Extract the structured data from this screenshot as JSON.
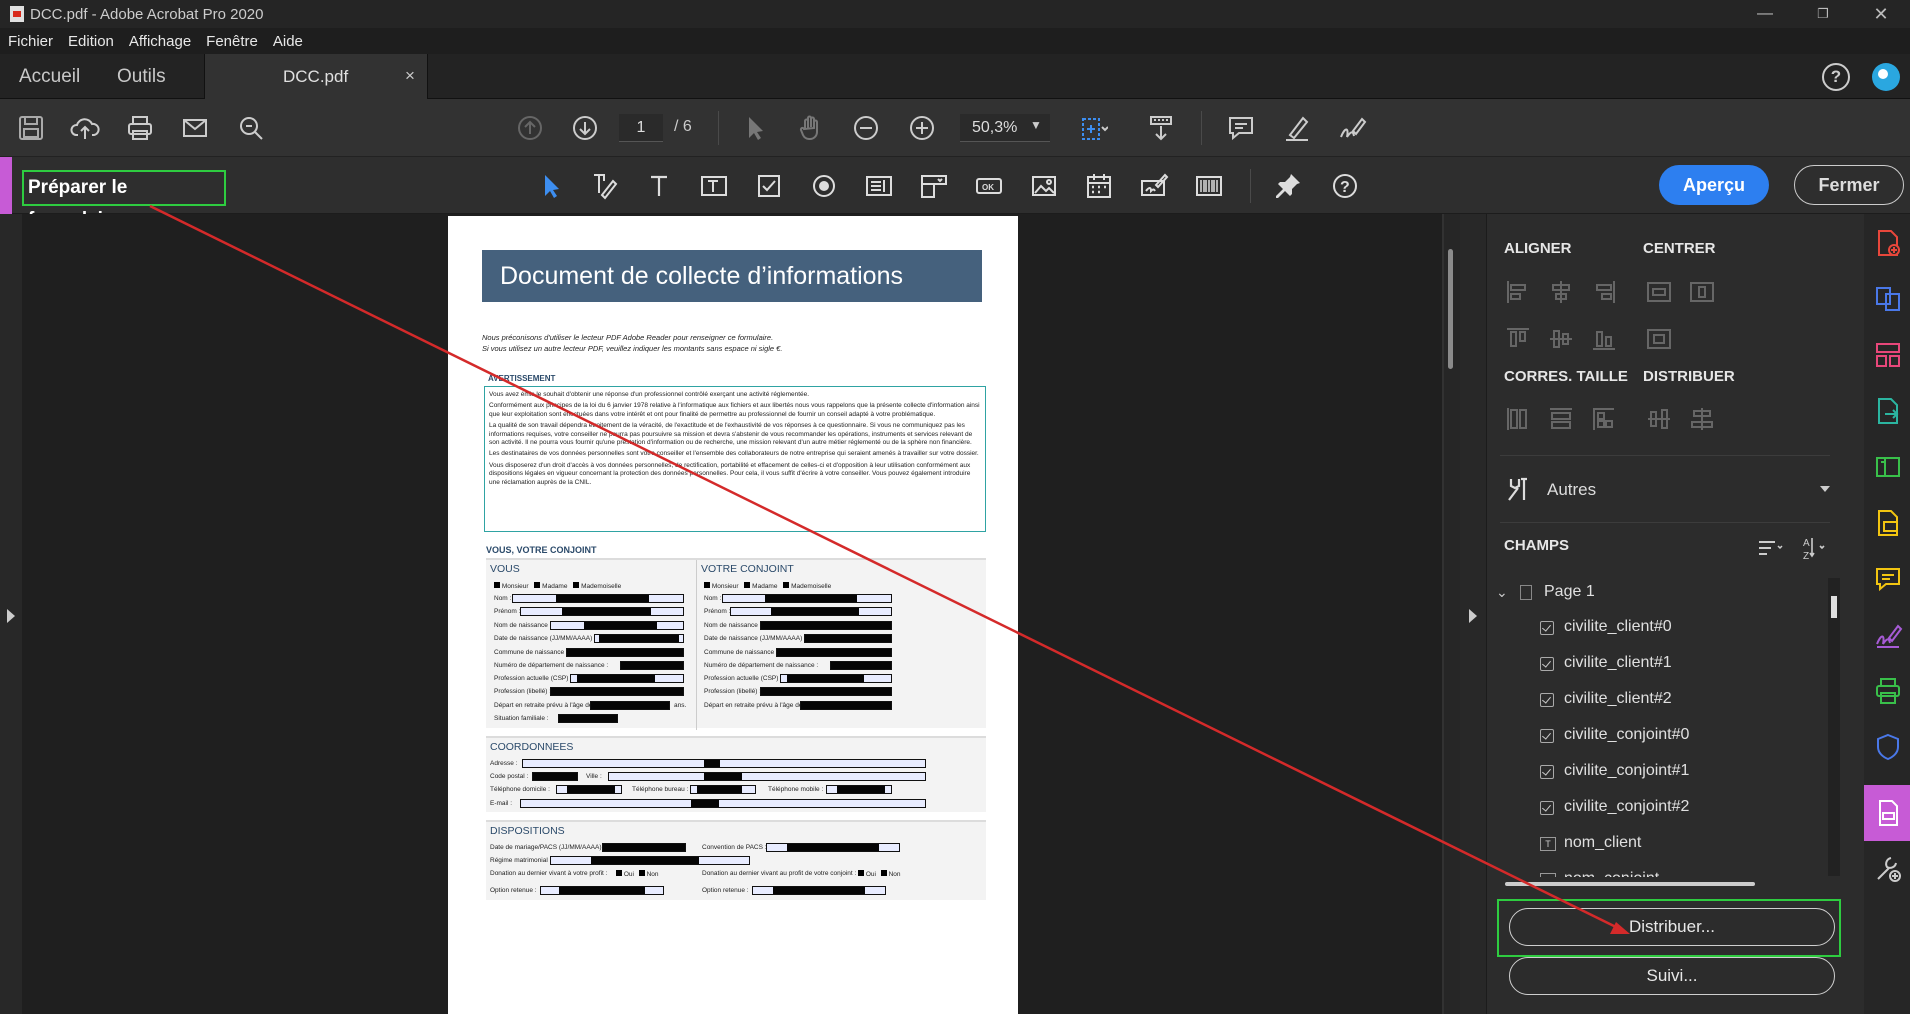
{
  "window": {
    "title": "DCC.pdf - Adobe Acrobat Pro 2020"
  },
  "menu": [
    "Fichier",
    "Edition",
    "Affichage",
    "Fenêtre",
    "Aide"
  ],
  "tabs": {
    "home": "Accueil",
    "tools": "Outils",
    "doc": "DCC.pdf",
    "close": "×"
  },
  "toolbar": {
    "page_current": "1",
    "page_total": "/ 6",
    "zoom": "50,3%"
  },
  "formbar": {
    "title": "Préparer le formulaire",
    "preview": "Aperçu",
    "close": "Fermer"
  },
  "panel": {
    "align": "ALIGNER",
    "center": "CENTRER",
    "resize": "CORRES. TAILLE",
    "distribute": "DISTRIBUER",
    "others": "Autres",
    "fields_title": "CHAMPS",
    "page_node": "Page 1",
    "fields": [
      "civilite_client#0",
      "civilite_client#1",
      "civilite_client#2",
      "civilite_conjoint#0",
      "civilite_conjoint#1",
      "civilite_conjoint#2",
      "nom_client",
      "nom_conjoint"
    ],
    "btn_distribute": "Distribuer...",
    "btn_track": "Suivi..."
  },
  "document": {
    "banner": "Document de collecte d’informations",
    "intro_1": "Nous préconisons d'utiliser le lecteur PDF Adobe Reader pour renseigner ce formulaire.",
    "intro_2": "Si vous utilisez un autre lecteur PDF, veuillez indiquer les montants sans espace ni sigle €.",
    "warning_title": "AVERTISSEMENT",
    "warning_paragraphs": [
      "Vous avez émis le souhait d'obtenir une réponse d'un professionnel contrôlé exerçant une activité réglementée.",
      "Conformément aux principes de la loi du 6 janvier 1978 relative à l'informatique aux fichiers et aux libertés nous vous rappelons que la présente collecte d'information ainsi que leur exploitation sont effectuées dans votre intérêt et ont pour finalité de permettre au professionnel de fournir un conseil adapté à votre problématique.",
      "La qualité de son travail dépendra étroitement de la véracité, de l'exactitude et de l'exhaustivité de vos réponses à ce questionnaire. Si vous ne communiquez pas les informations requises, votre conseiller ne pourra pas poursuivre sa mission et devra s'abstenir de vous recommander les opérations, instruments et services relevant de son activité. Il ne pourra vous fournir qu'une prestation d'information ou de recherche, une mission relevant d'un autre métier réglementé ou de la sphère non financière.",
      "Les destinataires de vos données personnelles sont votre conseiller et l'ensemble des collaborateurs de notre entreprise qui seraient amenés à travailler sur votre dossier.",
      "Vous disposerez d'un droit d'accès à vos données personnelles, de rectification, portabilité et effacement de celles-ci et d'opposition à leur utilisation conformément aux dispositions légales en vigueur concernant la protection des données personnelles. Pour cela, il vous suffit d'écrire à votre conseiller. Vous pouvez également introduire une réclamation auprès de la CNIL."
    ],
    "section_you": "VOUS, VOTRE CONJOINT",
    "col_you": "VOUS",
    "col_spouse": "VOTRE CONJOINT",
    "civility": [
      "Monsieur",
      "Madame",
      "Mademoiselle"
    ],
    "rows": [
      "Nom :",
      "Prénom :",
      "Nom de naissance :",
      "Date de naissance (JJ/MM/AAAA) :",
      "Commune de naissance :",
      "Numéro de département de naissance :",
      "Profession actuelle (CSP) :",
      "Profession (libellé) :",
      "Départ en retraite prévu à l'âge de"
    ],
    "ans": "ans.",
    "situation": "Situation familiale :",
    "coords": "COORDONNEES",
    "adresse": "Adresse :",
    "cp": "Code postal :",
    "ville": "Ville :",
    "tel_dom": "Téléphone domicile :",
    "tel_bur": "Téléphone bureau :",
    "tel_mob": "Téléphone mobile :",
    "email": "E-mail :",
    "dispositions": "DISPOSITIONS",
    "date_mariage": "Date de mariage/PACS (JJ/MM/AAAA) :",
    "convention": "Convention de PACS :",
    "regime": "Régime matrimonial :",
    "donation_you": "Donation au dernier vivant à votre profit :",
    "donation_spouse": "Donation au dernier vivant au profit de votre conjoint :",
    "oui": "Oui",
    "non": "Non",
    "option": "Option retenue :"
  }
}
